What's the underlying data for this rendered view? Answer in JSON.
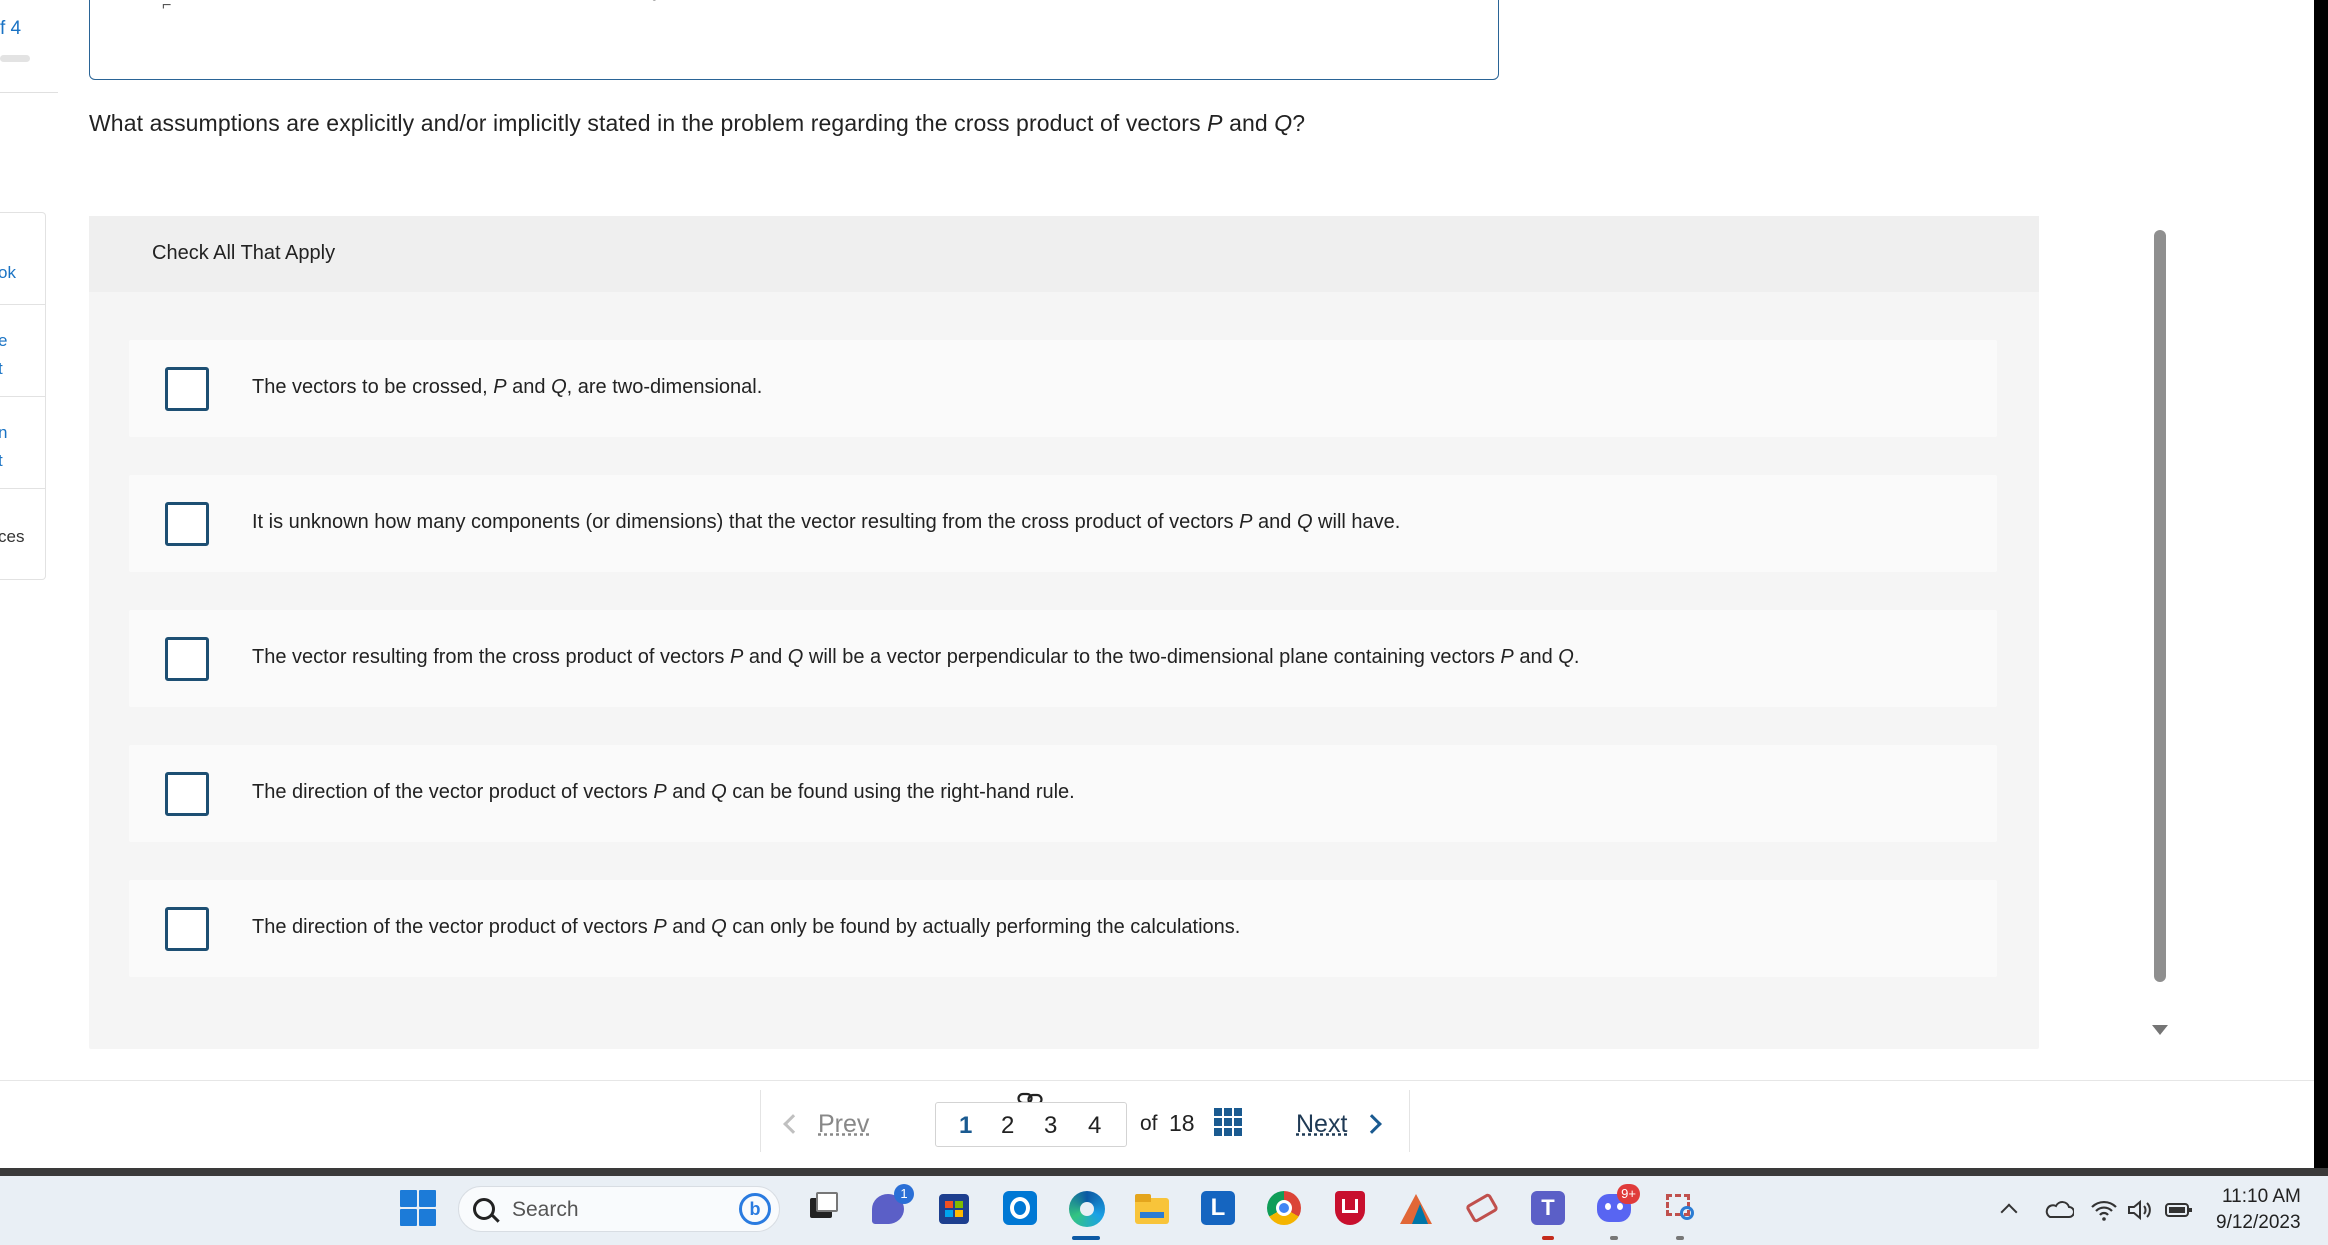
{
  "left_panel": {
    "progress_text": "f 4",
    "tools": [
      {
        "text": "ok"
      },
      {
        "text": "e\nt"
      },
      {
        "text": "n\nt"
      },
      {
        "text": "ces"
      }
    ]
  },
  "question": {
    "prefix": "What assumptions are explicitly and/or implicitly stated in the problem regarding the cross product of vectors ",
    "var_p": "P",
    "and": " and ",
    "var_q": "Q",
    "suffix": "?"
  },
  "panel": {
    "title": "Check All That Apply",
    "options": [
      {
        "parts": [
          "The vectors to be crossed, ",
          "P",
          " and ",
          "Q",
          ", are two-dimensional."
        ],
        "checked": false
      },
      {
        "parts": [
          "It is unknown how many components (or dimensions) that the vector resulting from the cross product of vectors ",
          "P",
          " and ",
          "Q",
          " will have."
        ],
        "checked": false
      },
      {
        "parts": [
          "The vector resulting from the cross product of vectors ",
          "P",
          " and ",
          "Q",
          " will be a vector perpendicular to the two-dimensional plane containing vectors ",
          "P",
          " and ",
          "Q",
          "."
        ],
        "checked": false
      },
      {
        "parts": [
          "The direction of the vector product of vectors ",
          "P",
          " and ",
          "Q",
          " can be found using the right-hand rule."
        ],
        "checked": false
      },
      {
        "parts": [
          "The direction of the vector product of vectors ",
          "P",
          " and ",
          "Q",
          " can only be found by actually performing the calculations."
        ],
        "checked": false
      }
    ]
  },
  "nav": {
    "prev_label": "Prev",
    "pages": [
      "1",
      "2",
      "3",
      "4"
    ],
    "current_page": "1",
    "of_label": "of",
    "total_pages": "18",
    "next_label": "Next"
  },
  "taskbar": {
    "search_label": "Search",
    "chat_badge": "1",
    "discord_badge": "9+",
    "clock_time": "11:10 AM",
    "clock_date": "9/12/2023"
  },
  "colors": {
    "accent": "#1a5a90",
    "checkbox_border": "#1d4f73",
    "panel_bg": "#f5f5f5",
    "option_bg": "#fafafa"
  }
}
